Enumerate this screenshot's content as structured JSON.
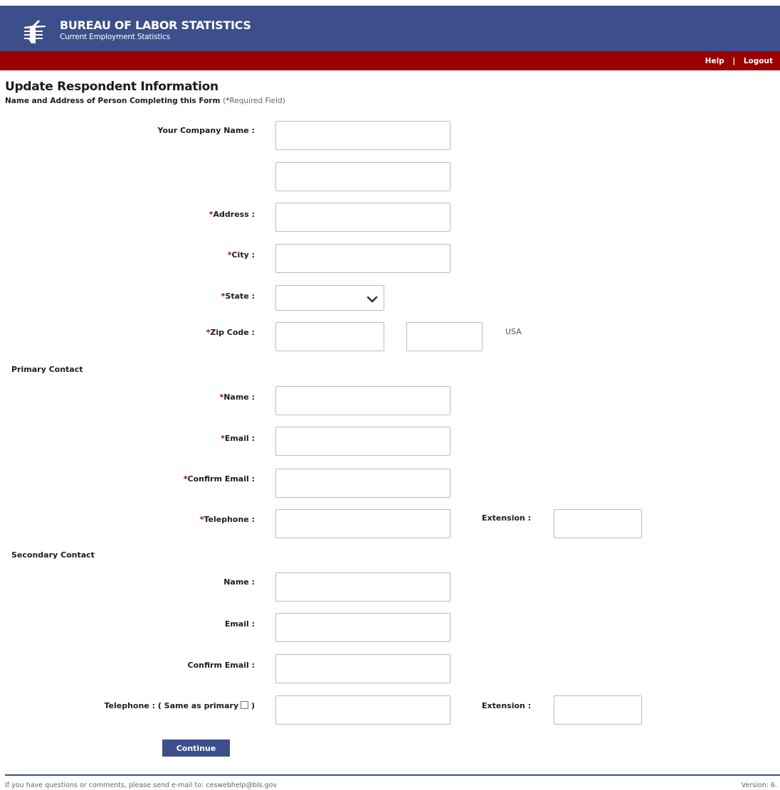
{
  "header": {
    "agency": "BUREAU OF LABOR STATISTICS",
    "program": "Current Employment Statistics",
    "links": [
      "Help",
      "Logout"
    ],
    "colors": {
      "banner": "#3c4f8a",
      "bar": "#9a0000"
    }
  },
  "page": {
    "title": "Update Respondent Information",
    "subtitle": "Name and Address of Person Completing this Form",
    "required_note_open": "(",
    "required_star": "*",
    "required_note": "Required Field)"
  },
  "form": {
    "company_name_label": "Your Company Name :",
    "address_label": "Address :",
    "city_label": "City :",
    "state_label": "State :",
    "zip_label": "Zip Code :",
    "country": "USA",
    "required_star": "*",
    "primary": {
      "heading": "Primary Contact",
      "name_label": "Name :",
      "email_label": "Email :",
      "confirm_email_label": "Confirm Email :",
      "telephone_label": "Telephone :",
      "extension_label": "Extension :"
    },
    "secondary": {
      "heading": "Secondary Contact",
      "name_label": "Name :",
      "email_label": "Email :",
      "confirm_email_label": "Confirm Email :",
      "telephone_label": "Telephone : ( Same as primary",
      "telephone_label_close": ")",
      "extension_label": "Extension :"
    },
    "continue_label": "Continue"
  },
  "footer": {
    "contact_text": "If you have questions or comments, please send e-mail to: ceswebhelp@bls.gov",
    "version": "Version: 6."
  },
  "icons": [
    "bls-logo-icon",
    "chevron-down-icon"
  ]
}
